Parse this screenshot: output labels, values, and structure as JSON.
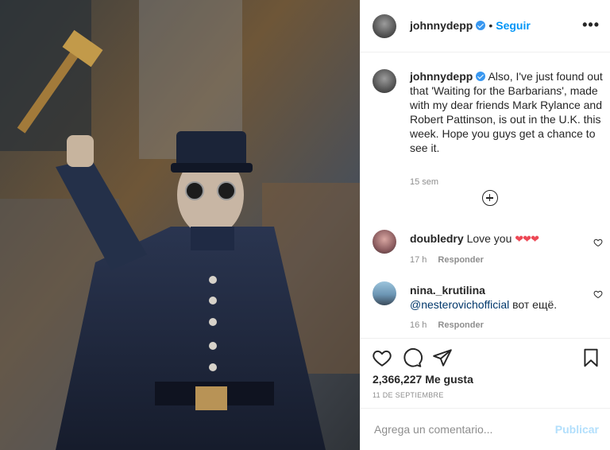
{
  "post": {
    "photo_icon": "post-photo",
    "colors": {
      "link": "#0095f6",
      "muted": "#8e8e8e",
      "heart": "#ed4956",
      "publish_disabled": "#b2dffc"
    }
  },
  "header": {
    "username": "johnnydepp",
    "separator": "•",
    "follow_label": "Seguir",
    "more_label": "•••"
  },
  "caption": {
    "username": "johnnydepp",
    "text": "Also, I've just found out that 'Waiting for the Barbarians', made with my dear friends Mark Rylance and Robert Pattinson, is out in the U.K. this week. Hope you guys get a chance to see it.",
    "time": "15 sem"
  },
  "comments": [
    {
      "username": "doubledry",
      "text": "Love you",
      "hearts": "❤❤❤",
      "time": "17 h",
      "reply_label": "Responder"
    },
    {
      "username": "nina._krutilina",
      "mention": "@nesterovichofficial",
      "text": "вот ещё.",
      "time": "16 h",
      "reply_label": "Responder"
    }
  ],
  "stats": {
    "likes_count": "2,366,227",
    "likes_label": "Me gusta",
    "date": "11 DE SEPTIEMBRE"
  },
  "comment_box": {
    "placeholder": "Agrega un comentario...",
    "publish_label": "Publicar"
  }
}
